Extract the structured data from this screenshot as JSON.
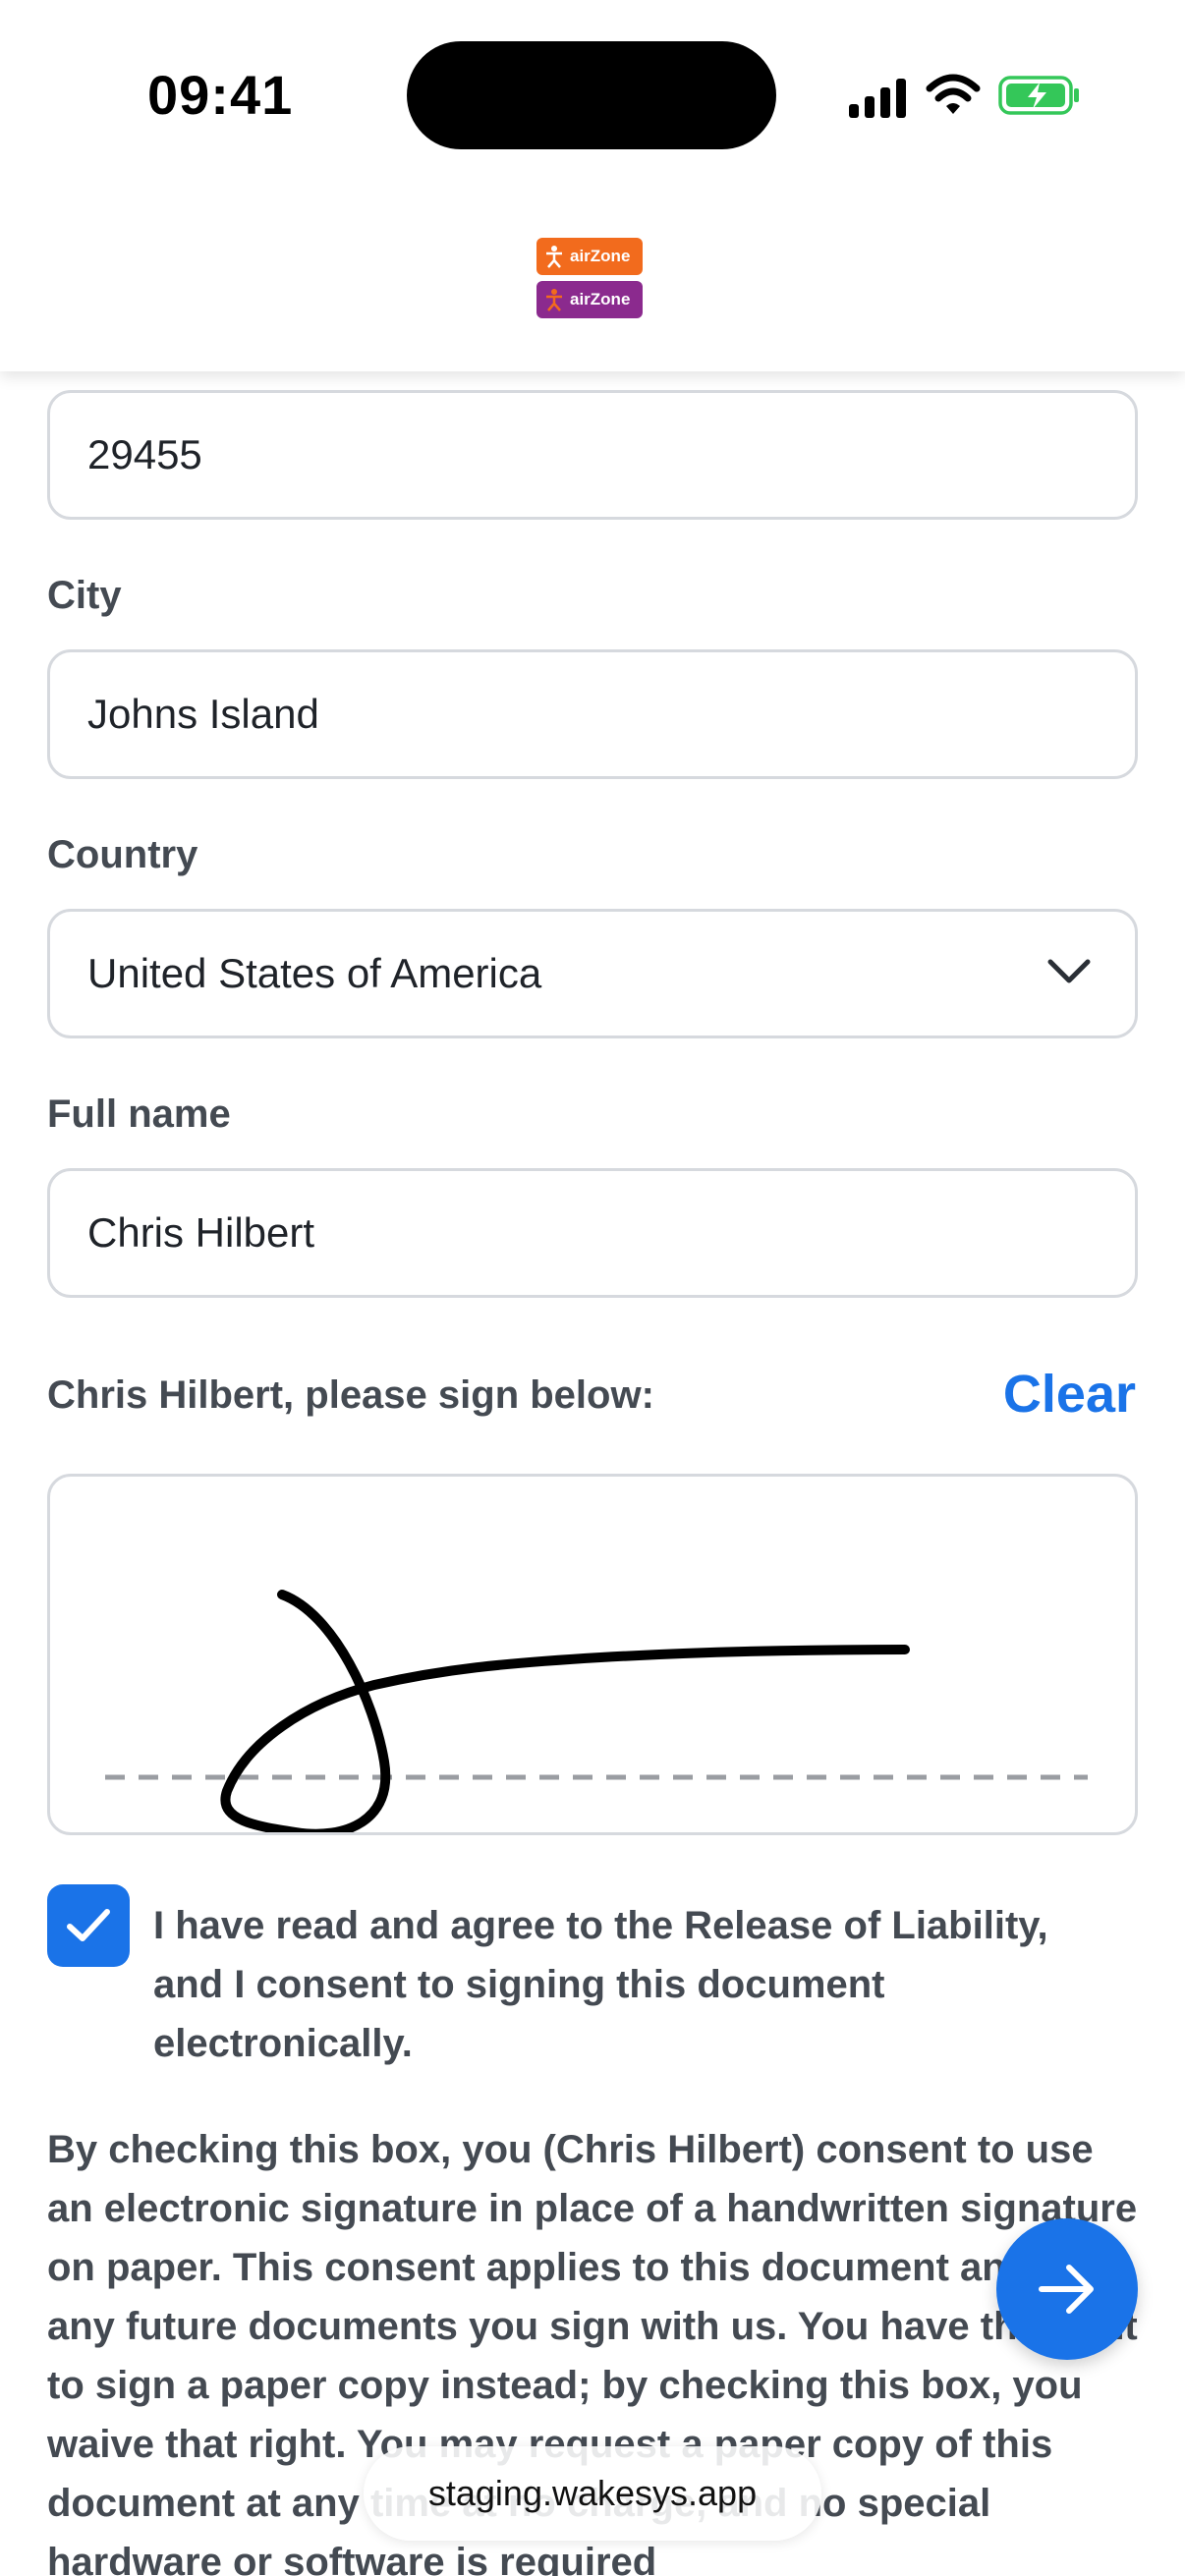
{
  "status_bar": {
    "time": "09:41"
  },
  "brand": {
    "logo_text_top": "airZone",
    "logo_text_bottom": "airZone"
  },
  "form": {
    "zip_value": "29455",
    "city_label": "City",
    "city_value": "Johns Island",
    "country_label": "Country",
    "country_value": "United States of America",
    "fullname_label": "Full name",
    "fullname_value": "Chris Hilbert"
  },
  "signature": {
    "prompt": "Chris Hilbert, please sign below:",
    "clear_label": "Clear"
  },
  "consent": {
    "checked": true,
    "text": "I have read and agree to the Release of Liability, and I consent to signing this document electronically."
  },
  "disclosure": {
    "text": "By checking this box, you (Chris Hilbert) consent to use an electronic signature in place of a handwritten signature on paper. This consent applies to this document and to any future documents you sign with us. You have the right to sign a paper copy instead; by checking this box, you waive that right. You may request a paper copy of this document at any time at no charge, and no special hardware or software is required"
  },
  "browser": {
    "url": "staging.wakesys.app"
  },
  "colors": {
    "accent": "#1a73e8",
    "brand_orange": "#f26b1d",
    "brand_purple": "#8b2a8e"
  },
  "icons": {
    "signal": "cellular-signal-icon",
    "wifi": "wifi-icon",
    "battery": "battery-charging-icon",
    "chevron": "chevron-down-icon",
    "check": "checkmark-icon",
    "next": "arrow-right-icon"
  }
}
